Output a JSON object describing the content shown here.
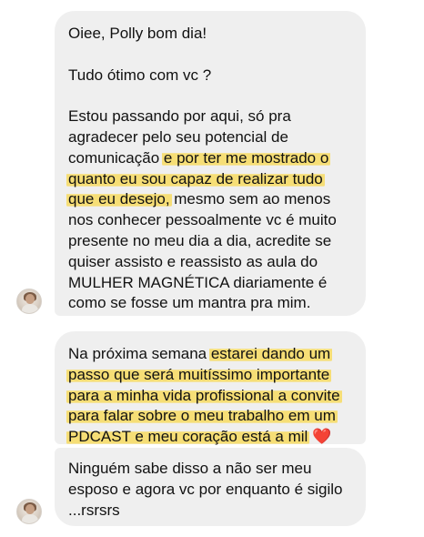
{
  "messages": [
    {
      "lines": [
        [
          {
            "t": "Oiee, Polly bom dia!"
          }
        ],
        "gap",
        [
          {
            "t": "Tudo ótimo com vc ?"
          }
        ],
        "gap",
        [
          {
            "t": "Estou passando por aqui, só pra"
          }
        ],
        [
          {
            "t": "agradecer pelo seu potencial de"
          }
        ],
        [
          {
            "t": "comunicação "
          },
          {
            "t": "e por ter me mostrado o",
            "hl": true
          }
        ],
        [
          {
            "t": "quanto eu sou capaz de realizar tudo",
            "hl": true
          }
        ],
        [
          {
            "t": "que eu desejo,",
            "hl": true
          },
          {
            "t": " mesmo sem ao menos"
          }
        ],
        [
          {
            "t": "nos conhecer pessoalmente vc é muito"
          }
        ],
        [
          {
            "t": "presente no meu dia a dia, acredite se"
          }
        ],
        [
          {
            "t": "quiser assisto e reassisto as aula do"
          }
        ],
        [
          {
            "t": "MULHER MAGNÉTICA diariamente é"
          }
        ],
        [
          {
            "t": "como se fosse um mantra pra mim."
          }
        ]
      ]
    },
    {
      "lines": [
        [
          {
            "t": "Na próxima semana "
          },
          {
            "t": "estarei dando um",
            "hl": true
          }
        ],
        [
          {
            "t": "passo que será muitíssimo importante",
            "hl": true
          }
        ],
        [
          {
            "t": "para a minha vida profissional a convite",
            "hl": true
          }
        ],
        [
          {
            "t": "para falar sobre o meu trabalho em um",
            "hl": true
          }
        ],
        [
          {
            "t": "PDCAST e meu coração está a mil",
            "hl": true
          },
          {
            "t": " "
          },
          {
            "t": "❤️",
            "heart": true
          }
        ]
      ]
    },
    {
      "lines": [
        [
          {
            "t": "Ninguém sabe disso a não ser meu"
          }
        ],
        [
          {
            "t": "esposo e agora vc por enquanto é sigilo"
          }
        ],
        [
          {
            "t": "...rsrsrs"
          }
        ]
      ]
    }
  ],
  "avatar": {
    "icon": "profile-photo-avatar"
  },
  "colors": {
    "bubble": "#efefef",
    "highlight": "#f7dc69",
    "heart": "#e3263a",
    "text": "#111111"
  }
}
